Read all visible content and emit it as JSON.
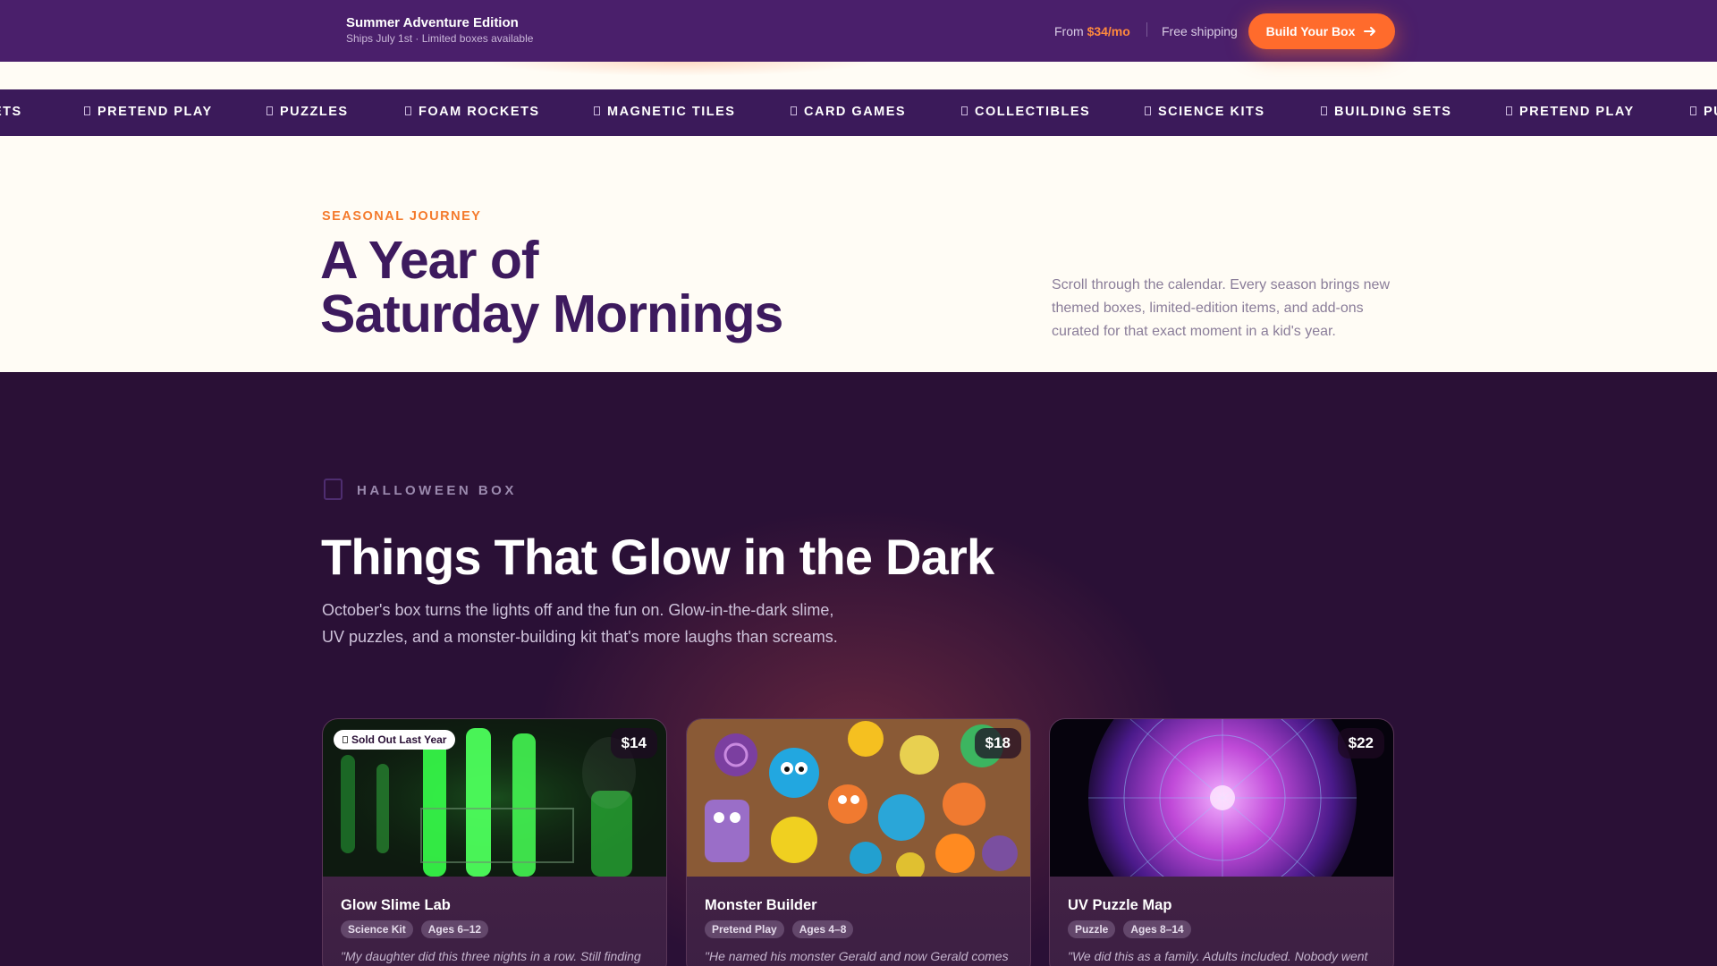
{
  "promo": {
    "title": "Summer Adventure Edition",
    "subtitle": "Ships July 1st · Limited boxes available",
    "price_prefix": "From ",
    "price_value": "$34/mo",
    "shipping": "Free shipping",
    "cta_label": "Build Your Box",
    "cta_icon": "arrow-right-icon"
  },
  "marquee": {
    "items": [
      "ETS",
      "PRETEND PLAY",
      "PUZZLES",
      "FOAM ROCKETS",
      "MAGNETIC TILES",
      "CARD GAMES",
      "COLLECTIBLES",
      "SCIENCE KITS",
      "BUILDING SETS",
      "PRETEND PLAY",
      "PU"
    ]
  },
  "journey": {
    "eyebrow": "SEASONAL JOURNEY",
    "title_line1": "A Year of",
    "title_line2": "Saturday Mornings",
    "description": "Scroll through the calendar. Every season brings new themed boxes, limited-edition items, and add-ons curated for that exact moment in a kid's year."
  },
  "season": {
    "label": "HALLOWEEN BOX",
    "title": "Things That Glow in the Dark",
    "description": "October's box turns the lights off and the fun on. Glow-in-the-dark slime, UV puzzles, and a monster-building kit that's more laughs than screams."
  },
  "cards": [
    {
      "name": "Glow Slime Lab",
      "price": "$14",
      "badge": "Sold Out Last Year",
      "tags": [
        "Science Kit",
        "Ages 6–12"
      ],
      "quote": "\"My daughter did this three nights in a row. Still finding"
    },
    {
      "name": "Monster Builder",
      "price": "$18",
      "tags": [
        "Pretend Play",
        "Ages 4–8"
      ],
      "quote": "\"He named his monster Gerald and now Gerald comes"
    },
    {
      "name": "UV Puzzle Map",
      "price": "$22",
      "tags": [
        "Puzzle",
        "Ages 8–14"
      ],
      "quote": "\"We did this as a family. Adults included. Nobody went"
    }
  ],
  "colors": {
    "promo_bg": "#4a1f6b",
    "accent": "#ff6b2c",
    "heading": "#3d1a5e",
    "dark_bg": "#2a1036"
  }
}
